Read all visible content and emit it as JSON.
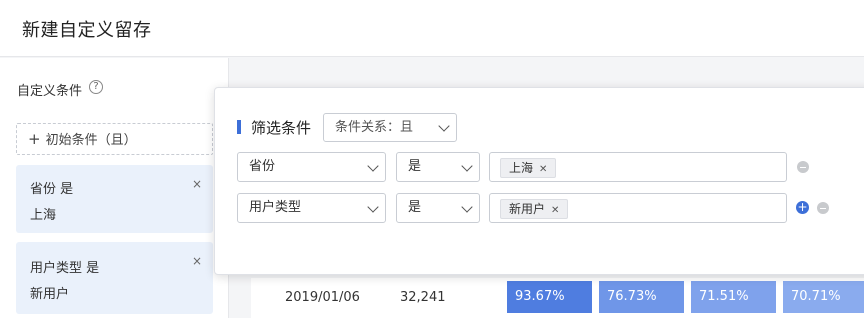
{
  "page_title": "新建自定义留存",
  "sidebar": {
    "section_title": "自定义条件",
    "help_glyph": "?",
    "init_button_label": "初始条件（且）",
    "conditions": [
      {
        "line1": "省份 是",
        "line2": "上海",
        "remove_glyph": "×"
      },
      {
        "line1": "用户类型 是",
        "line2": "新用户",
        "remove_glyph": "×"
      }
    ]
  },
  "filter_popover": {
    "title": "筛选条件",
    "relation_select": "条件关系：且",
    "rows": [
      {
        "field": "省份",
        "operator": "是",
        "tags": [
          "上海"
        ]
      },
      {
        "field": "用户类型",
        "operator": "是",
        "tags": [
          "新用户"
        ]
      }
    ]
  },
  "table": {
    "row": {
      "date": "2019/01/06",
      "count": "32,241",
      "cells": [
        "93.67%",
        "76.73%",
        "71.51%",
        "70.71%"
      ]
    }
  },
  "colors": {
    "accent": "#3d6fd8",
    "cell_backgrounds": [
      "#4f7de0",
      "#6f96e8",
      "#7fa2ec",
      "#8aabee"
    ],
    "card_bg": "#eaf1fb"
  },
  "icons": {
    "plus": "plus-icon",
    "remove": "close-icon",
    "help": "help-icon",
    "chevron": "chevron-down-icon",
    "add_row": "add-circle-icon",
    "delete_row": "minus-circle-icon"
  }
}
